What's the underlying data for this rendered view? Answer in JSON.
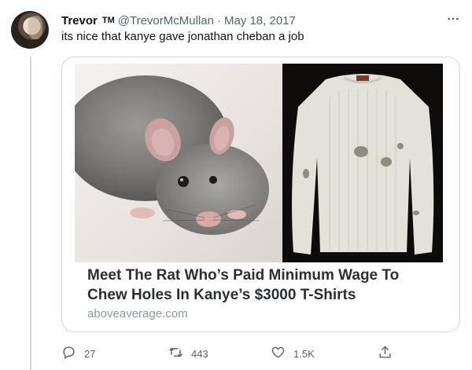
{
  "tweet": {
    "author_name": "Trevor",
    "author_badge": "TM",
    "handle": "@TrevorMcMullan",
    "separator": "·",
    "date": "May 18, 2017",
    "text": "its nice that kanye gave jonathan cheban a job",
    "more_icon": "more-horizontal-icon"
  },
  "card": {
    "title": "Meet The Rat Who’s Paid Minimum Wage To Chew Holes In Kanye’s $3000 T-Shirts",
    "domain": "aboveaverage.com"
  },
  "actions": {
    "reply_count": "27",
    "retweet_count": "443",
    "like_count": "1.5K",
    "share_icon": "share-icon"
  },
  "colors": {
    "text_primary": "#0f1419",
    "text_secondary": "#536471",
    "border": "#cfd9de"
  }
}
